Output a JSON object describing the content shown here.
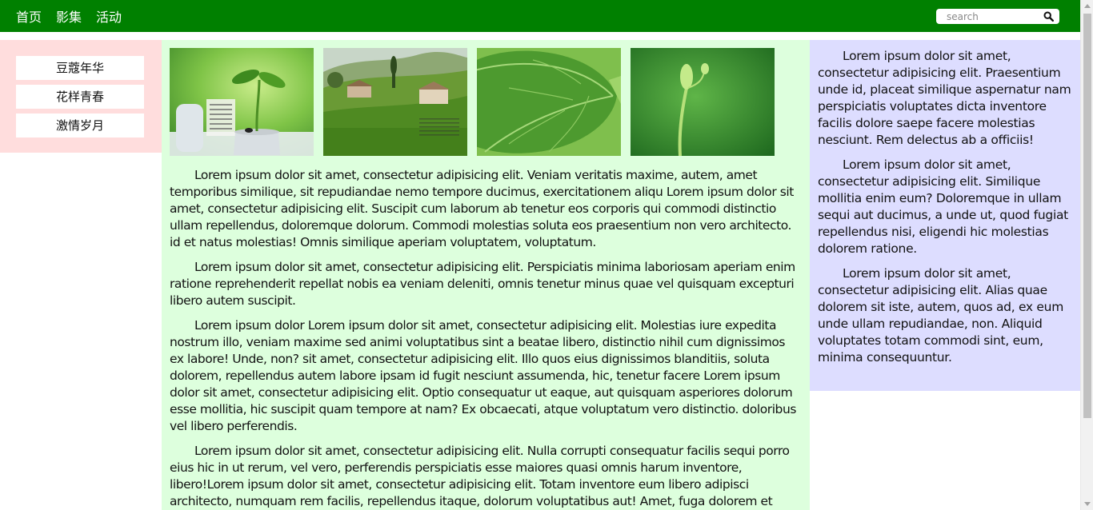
{
  "nav": {
    "items": [
      {
        "label": "首页"
      },
      {
        "label": "影集"
      },
      {
        "label": "活动"
      }
    ]
  },
  "search": {
    "placeholder": "search",
    "icon": "search-icon"
  },
  "sidebar": {
    "items": [
      {
        "label": "豆蔻年华"
      },
      {
        "label": "花样青春"
      },
      {
        "label": "激情岁月"
      }
    ]
  },
  "gallery": {
    "images": [
      {
        "name": "seedling-calendar-image"
      },
      {
        "name": "countryside-landscape-image"
      },
      {
        "name": "leaf-image"
      },
      {
        "name": "sprout-image"
      }
    ]
  },
  "main": {
    "paragraphs": [
      "Lorem ipsum dolor sit amet, consectetur adipisicing elit. Veniam veritatis maxime, autem, amet temporibus similique, sit repudiandae nemo tempore ducimus, exercitationem aliqu Lorem ipsum dolor sit amet, consectetur adipisicing elit. Suscipit cum laborum ab tenetur eos corporis qui commodi distinctio ullam repellendus, doloremque dolorum. Commodi molestias soluta eos praesentium non vero architecto. id et natus molestias! Omnis similique aperiam voluptatem, voluptatum.",
      "Lorem ipsum dolor sit amet, consectetur adipisicing elit. Perspiciatis minima laboriosam aperiam enim ratione reprehenderit repellat nobis ea veniam deleniti, omnis tenetur minus quae vel quisquam excepturi libero autem suscipit.",
      "Lorem ipsum dolor Lorem ipsum dolor sit amet, consectetur adipisicing elit. Molestias iure expedita nostrum illo, veniam maxime sed animi voluptatibus sint a beatae libero, distinctio nihil cum dignissimos ex labore! Unde, non? sit amet, consectetur adipisicing elit. Illo quos eius dignissimos blanditiis, soluta dolorem, repellendus autem labore ipsam id fugit nesciunt assumenda, hic, tenetur facere Lorem ipsum dolor sit amet, consectetur adipisicing elit. Optio consequatur ut eaque, aut quisquam asperiores dolorum esse mollitia, hic suscipit quam tempore at nam? Ex obcaecati, atque voluptatum vero distinctio. doloribus vel libero perferendis.",
      "Lorem ipsum dolor sit amet, consectetur adipisicing elit. Nulla corrupti consequatur facilis sequi porro eius hic in ut rerum, vel vero, perferendis perspiciatis esse maiores quasi omnis harum inventore, libero!Lorem ipsum dolor sit amet, consectetur adipisicing elit. Totam inventore eum libero adipisci architecto, numquam rem facilis, repellendus itaque, dolorum voluptatibus aut! Amet, fuga dolorem et"
    ]
  },
  "aside": {
    "paragraphs": [
      "Lorem ipsum dolor sit amet, consectetur adipisicing elit. Praesentium unde id, placeat similique aspernatur nam perspiciatis voluptates dicta inventore facilis dolore saepe facere molestias nesciunt. Rem delectus ab a officiis!",
      "Lorem ipsum dolor sit amet, consectetur adipisicing elit. Similique mollitia enim eum? Doloremque in ullam sequi aut ducimus, a unde ut, quod fugiat repellendus nisi, eligendi hic molestias dolorem ratione.",
      "Lorem ipsum dolor sit amet, consectetur adipisicing elit. Alias quae dolorem sit iste, autem, quos ad, ex eum unde ullam repudiandae, non. Aliquid voluptates totam commodi sint, eum, minima consequuntur."
    ]
  },
  "colors": {
    "topbar": "#008000",
    "sidebar_bg": "#ffdddd",
    "main_bg": "#ddffdd",
    "aside_bg": "#ddddff"
  }
}
